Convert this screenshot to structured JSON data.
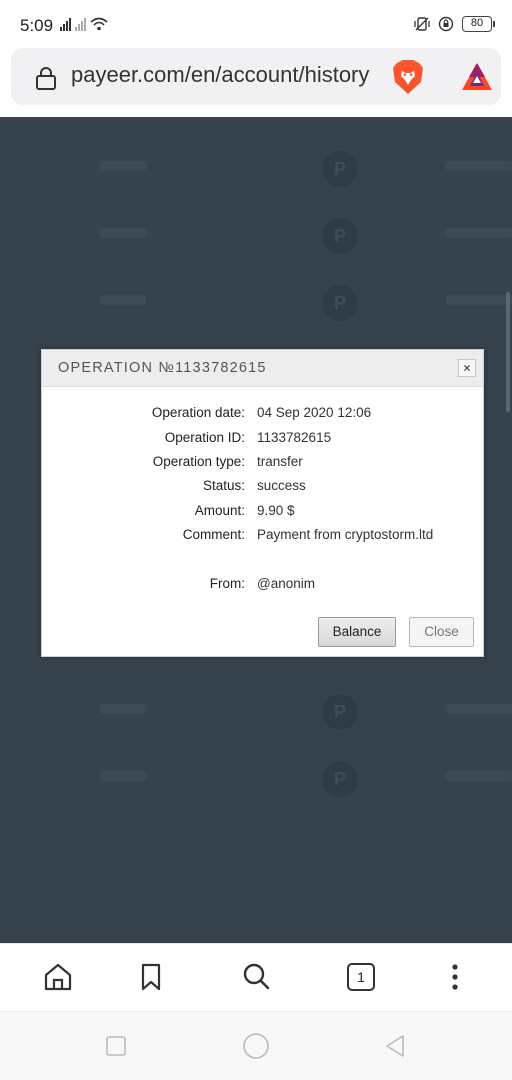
{
  "status_bar": {
    "time": "5:09",
    "battery": "80"
  },
  "url_bar": {
    "url": "payeer.com/en/account/history"
  },
  "dialog": {
    "title": "OPERATION №1133782615",
    "fields": [
      {
        "label": "Operation date:",
        "value": "04 Sep 2020 12:06"
      },
      {
        "label": "Operation ID:",
        "value": "1133782615"
      },
      {
        "label": "Operation type:",
        "value": "transfer"
      },
      {
        "label": "Status:",
        "value": "success"
      },
      {
        "label": "Amount:",
        "value": "9.90 $"
      },
      {
        "label": "Comment:",
        "value": "Payment from cryptostorm.ltd"
      },
      {
        "label": "From:",
        "value": "@anonim"
      }
    ],
    "close_x": "×",
    "balance_button": "Balance",
    "close_button": "Close"
  },
  "toolbar": {
    "items": [
      "home-icon",
      "bookmark-icon",
      "search-icon",
      "tabs-count",
      "menu-icon"
    ],
    "tab_count": "1"
  },
  "colors": {
    "page_background": "#36434d",
    "brave_orange": "#fb542b",
    "bat_orange": "#ff4724"
  }
}
